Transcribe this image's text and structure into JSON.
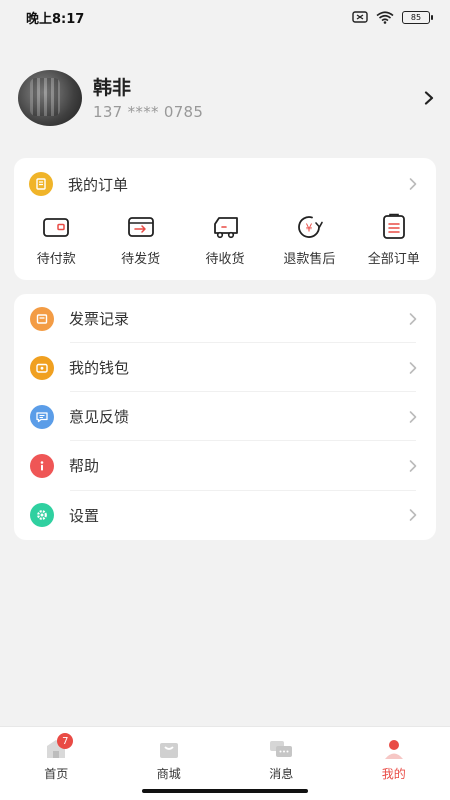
{
  "status_bar": {
    "time": "晚上8:17",
    "battery": "85"
  },
  "profile": {
    "name": "韩非",
    "phone": "137 **** 0785"
  },
  "orders": {
    "title": "我的订单",
    "items": [
      {
        "label": "待付款",
        "icon": "wallet-icon"
      },
      {
        "label": "待发货",
        "icon": "ship-box-icon"
      },
      {
        "label": "待收货",
        "icon": "truck-icon"
      },
      {
        "label": "退款售后",
        "icon": "refund-icon"
      },
      {
        "label": "全部订单",
        "icon": "order-list-icon"
      }
    ]
  },
  "menu": [
    {
      "label": "发票记录",
      "icon": "invoice-icon",
      "color": "#f39c45"
    },
    {
      "label": "我的钱包",
      "icon": "wallet-icon",
      "color": "#f0a020"
    },
    {
      "label": "意见反馈",
      "icon": "feedback-icon",
      "color": "#5b9de8"
    },
    {
      "label": "帮助",
      "icon": "info-icon",
      "color": "#ef5656"
    },
    {
      "label": "设置",
      "icon": "gear-icon",
      "color": "#2fd0a0"
    }
  ],
  "tabs": [
    {
      "label": "首页",
      "badge": "7"
    },
    {
      "label": "商城"
    },
    {
      "label": "消息"
    },
    {
      "label": "我的"
    }
  ],
  "colors": {
    "accent": "#e94b45",
    "order_icon": "#f0b429"
  }
}
